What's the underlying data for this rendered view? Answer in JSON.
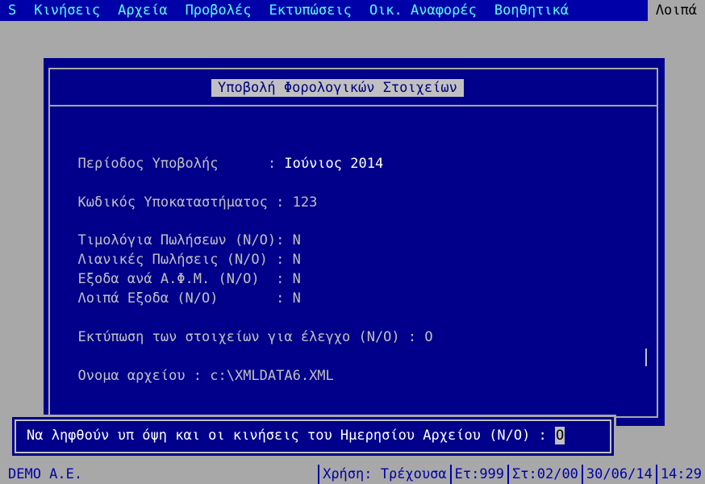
{
  "menu": [
    {
      "label": "S"
    },
    {
      "label": "Κινήσεις"
    },
    {
      "label": "Αρχεία"
    },
    {
      "label": "Προβολές"
    },
    {
      "label": "Εκτυπώσεις"
    },
    {
      "label": "Οικ. Αναφορές"
    },
    {
      "label": "Βοηθητικά"
    },
    {
      "label": "Λοιπά"
    }
  ],
  "dialog": {
    "title": "Υποβολή Φορολογικών Στοιχείων",
    "fields": [
      {
        "label": "Περίοδος Υποβολής      : ",
        "value": "Ιούνιος 2014"
      },
      {
        "label": "Κωδικός Υποκαταστήματος : ",
        "value": "123"
      },
      {
        "label": "Τιμολόγια Πωλήσεων (Ν/Ο): ",
        "value": "N"
      },
      {
        "label": "Λιανικές Πωλήσεις (Ν/Ο) : ",
        "value": "N"
      },
      {
        "label": "Εξοδα ανά Α.Φ.Μ. (Ν/Ο)  : ",
        "value": "N"
      },
      {
        "label": "Λοιπά Εξοδα (Ν/Ο)       : ",
        "value": "N"
      },
      {
        "label": "Εκτύπωση των στοιχείων για έλεγχο (Ν/Ο) : ",
        "value": "O"
      },
      {
        "label": "Ονομα αρχείου : ",
        "value": "c:\\XMLDATA6.XML"
      }
    ]
  },
  "prompt": {
    "text": "Να ληφθούν υπ όψη και οι κινήσεις του Ημερησίου Αρχείου (Ν/Ο) : ",
    "value": "O"
  },
  "status": {
    "company": "DEMO A.E.",
    "usage": "Χρήση: Τρέχουσα",
    "year": "Ετ:999",
    "station": "Στ:02/00",
    "date": "30/06/14",
    "time": "14:29"
  },
  "colors": {
    "background": "#a8a8a8",
    "menu_bg": "#0000a8",
    "menu_text": "#55ffff",
    "dialog_bg": "#00008a"
  }
}
